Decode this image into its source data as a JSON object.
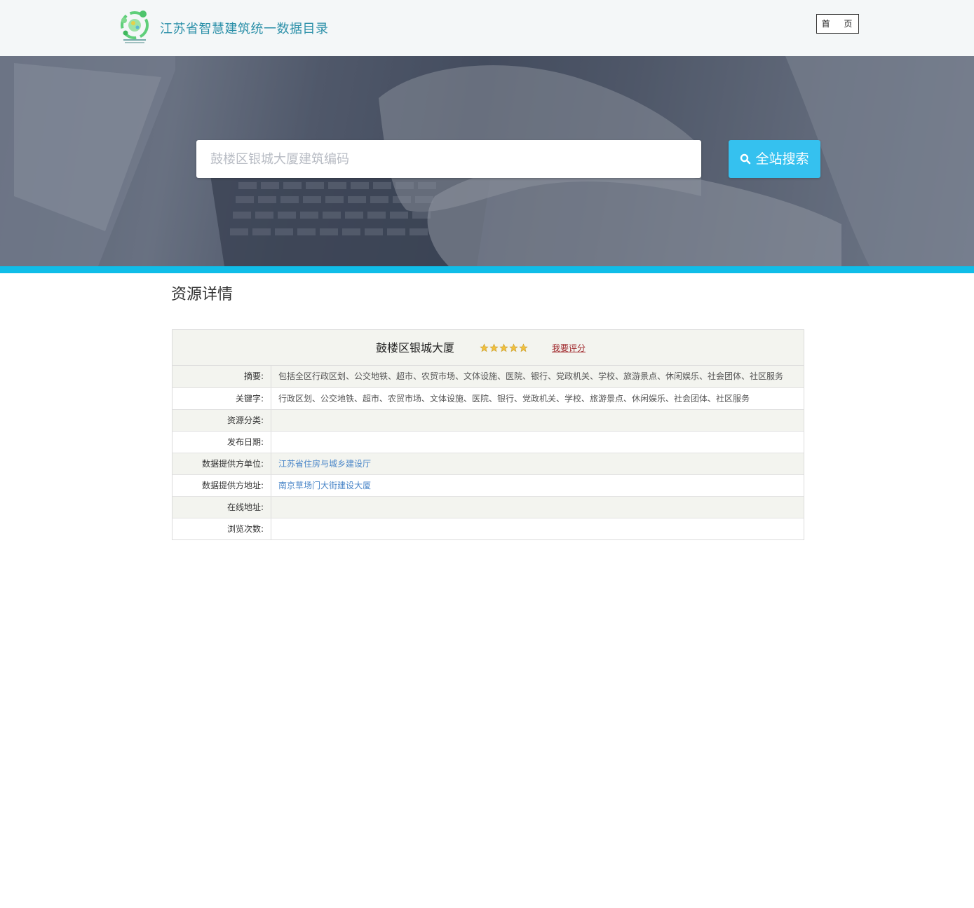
{
  "header": {
    "site_title": "江苏省智慧建筑统一数据目录",
    "home_label": "首 页"
  },
  "search": {
    "placeholder": "鼓楼区银城大厦建筑编码",
    "button_label": "全站搜索"
  },
  "section": {
    "title": "资源详情"
  },
  "resource": {
    "name": "鼓楼区银城大厦",
    "rating": 5,
    "rating_max": 5,
    "rate_link": "我要评分"
  },
  "details": [
    {
      "label": "摘要:",
      "value": "包括全区行政区划、公交地铁、超市、农贸市场、文体设施、医院、银行、党政机关、学校、旅游景点、休闲娱乐、社会团体、社区服务",
      "link": false
    },
    {
      "label": "关键字:",
      "value": "行政区划、公交地铁、超市、农贸市场、文体设施、医院、银行、党政机关、学校、旅游景点、休闲娱乐、社会团体、社区服务",
      "link": false
    },
    {
      "label": "资源分类:",
      "value": "",
      "link": false
    },
    {
      "label": "发布日期:",
      "value": "",
      "link": false
    },
    {
      "label": "数据提供方单位:",
      "value": "江苏省住房与城乡建设厅",
      "link": true
    },
    {
      "label": "数据提供方地址:",
      "value": "南京草场门大街建设大厦",
      "link": true
    },
    {
      "label": "在线地址:",
      "value": "",
      "link": false
    },
    {
      "label": "浏览次数:",
      "value": "",
      "link": false
    }
  ],
  "colors": {
    "accent": "#35c1ef",
    "banner_bar": "#10bde8",
    "title": "#2a8fa8",
    "link": "#4a86c8",
    "rate_link": "#a0282c",
    "star": "#f0c040"
  }
}
